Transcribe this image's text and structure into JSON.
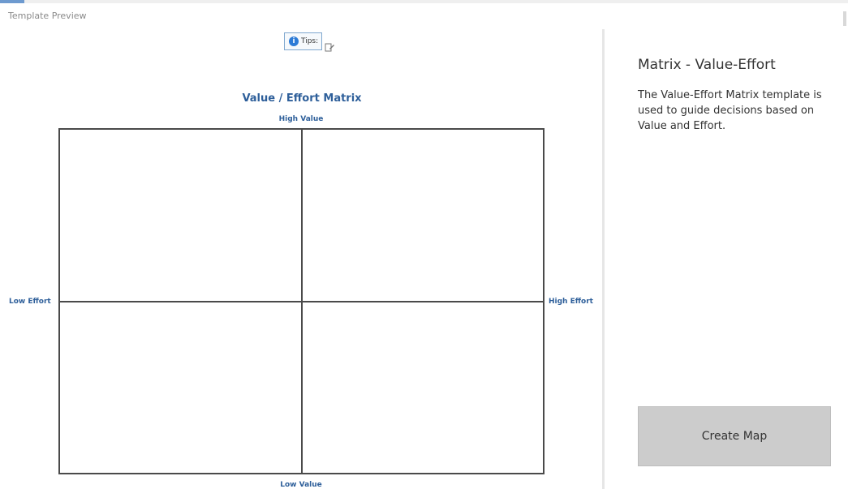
{
  "window": {
    "title": "Template Preview"
  },
  "tips": {
    "label": "Tips:",
    "icon": "info-icon"
  },
  "matrix": {
    "title": "Value / Effort Matrix",
    "labels": {
      "top": "High Value",
      "bottom": "Low Value",
      "left": "Low Effort",
      "right": "High Effort"
    },
    "title_color": "#2e5f9a"
  },
  "details": {
    "name": "Matrix - Value-Effort",
    "description": "The Value-Effort Matrix template is used to guide decisions based on Value and Effort."
  },
  "actions": {
    "create_map_label": "Create Map"
  }
}
